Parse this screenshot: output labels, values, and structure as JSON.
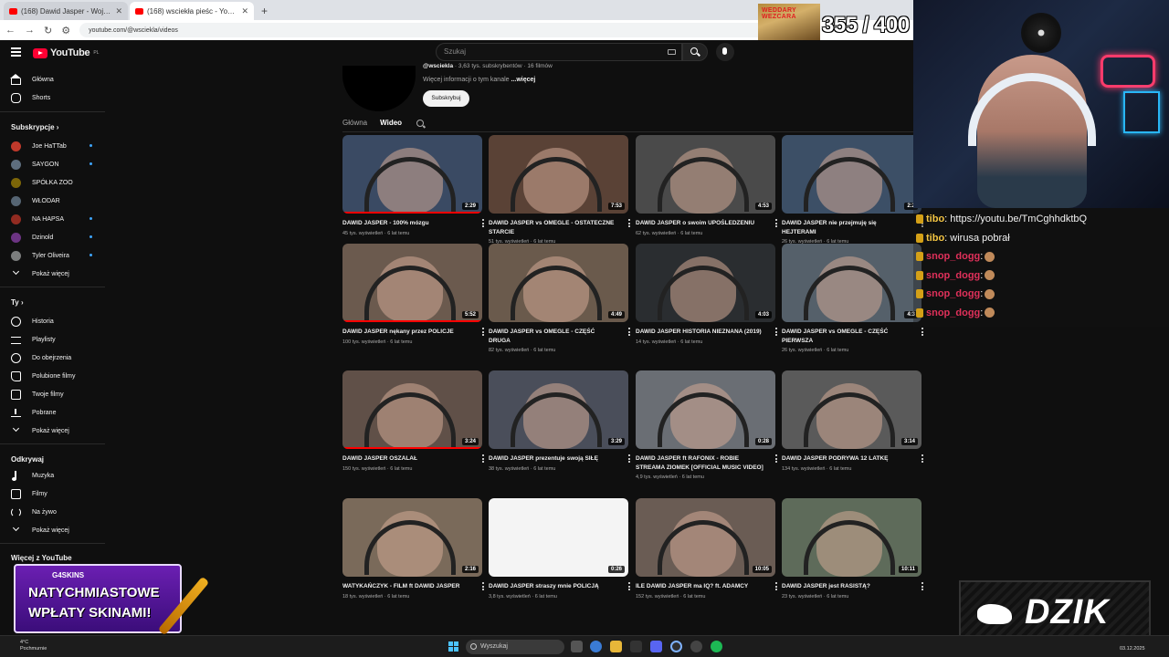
{
  "browser": {
    "tabs": [
      {
        "title": "(168) Dawid Jasper - Wojna z Di..."
      },
      {
        "title": "(168) wsciekła pieśc - YouTube"
      }
    ],
    "url": "youtube.com/@wsciekla/videos"
  },
  "youtube": {
    "logo": "YouTube",
    "logo_region": "PL",
    "search_placeholder": "Szukaj"
  },
  "sidebar": {
    "main": [
      {
        "label": "Główna",
        "icon": "home-icon"
      },
      {
        "label": "Shorts",
        "icon": "shorts-icon"
      }
    ],
    "subs_heading": "Subskrypcje",
    "subscriptions": [
      {
        "label": "Joe HaTTab",
        "color": "#c0392b"
      },
      {
        "label": "SAYGON",
        "color": "#5d6d7e"
      },
      {
        "label": "SPÓŁKA ZOO",
        "color": "#7d6608"
      },
      {
        "label": "WŁODAR",
        "color": "#566573"
      },
      {
        "label": "NA HAPSA",
        "color": "#922b21"
      },
      {
        "label": "Dzinold",
        "color": "#6c3483"
      },
      {
        "label": "Tyler Oliveira",
        "color": "#7b7d7d"
      }
    ],
    "subs_more": "Pokaż więcej",
    "you_heading": "Ty",
    "you": [
      {
        "label": "Historia"
      },
      {
        "label": "Playlisty"
      },
      {
        "label": "Do obejrzenia"
      },
      {
        "label": "Polubione filmy"
      },
      {
        "label": "Twoje filmy"
      },
      {
        "label": "Pobrane"
      },
      {
        "label": "Pokaż więcej"
      }
    ],
    "explore_heading": "Odkrywaj",
    "explore": [
      {
        "label": "Muzyka"
      },
      {
        "label": "Filmy"
      },
      {
        "label": "Na żywo"
      },
      {
        "label": "Pokaż więcej"
      }
    ],
    "more_heading": "Więcej z YouTube"
  },
  "channel": {
    "handle": "@wsciekla",
    "stats": " · 3,63 tys. subskrybentów · 16 filmów",
    "desc": "Więcej informacji o tym kanale ",
    "desc_more": "...więcej",
    "subscribe": "Subskrybuj",
    "tabs": [
      "Główna",
      "Wideo"
    ]
  },
  "videos": [
    {
      "title": "DAWID JASPER - 100% mózgu",
      "meta": "45 tys. wyświetleń · 6 lat temu",
      "duration": "2:29",
      "bg": "#3a4a63"
    },
    {
      "title": "DAWID JASPER vs OMEGLE - OSTATECZNE STARCIE",
      "meta": "51 tys. wyświetleń · 6 lat temu",
      "duration": "7:53",
      "bg": "#5a4236"
    },
    {
      "title": "DAWID JASPER o swoim UPOŚLEDZENIU",
      "meta": "62 tys. wyświetleń · 6 lat temu",
      "duration": "4:53",
      "bg": "#4a4a4a"
    },
    {
      "title": "DAWID JASPER nie przejmuję się HEJTERAMI",
      "meta": "26 tys. wyświetleń · 6 lat temu",
      "duration": "2:2",
      "bg": "#3c4f66"
    },
    {
      "title": "DAWID JASPER nękany przez POLICJE",
      "meta": "100 tys. wyświetleń · 6 lat temu",
      "duration": "5:52",
      "bg": "#6b5a4e"
    },
    {
      "title": "DAWID JASPER vs OMEGLE - CZĘŚĆ DRUGA",
      "meta": "82 tys. wyświetleń · 6 lat temu",
      "duration": "4:49",
      "bg": "#6a5a4c"
    },
    {
      "title": "DAWID JASPER HISTORIA NIEZNANA (2019)",
      "meta": "14 tys. wyświetleń · 6 lat temu",
      "duration": "4:03",
      "bg": "#2a2d30"
    },
    {
      "title": "DAWID JASPER vs OMEGLE - CZĘŚĆ PIERWSZA",
      "meta": "26 tys. wyświetleń · 6 lat temu",
      "duration": "4:3",
      "bg": "#55606a"
    },
    {
      "title": "DAWID JASPER OSZALAŁ",
      "meta": "150 tys. wyświetleń · 6 lat temu",
      "duration": "3:24",
      "bg": "#605048"
    },
    {
      "title": "DAWID JASPER prezentuje swoją SIŁĘ",
      "meta": "38 tys. wyświetleń · 6 lat temu",
      "duration": "3:29",
      "bg": "#4a4e5a"
    },
    {
      "title": "DAWID JASPER ft RAFONIX - ROBIE STREAMA ZIOMEK [OFFICIAL MUSIC VIDEO]",
      "meta": "4,9 tys. wyświetleń · 6 lat temu",
      "duration": "0:28",
      "bg": "#6a6e74"
    },
    {
      "title": "DAWID JASPER PODRYWA 12 LATKĘ",
      "meta": "134 tys. wyświetleń · 6 lat temu",
      "duration": "3:14",
      "bg": "#5a5a5a"
    },
    {
      "title": "WATYKAŃCZYK - FILM ft DAWID JASPER",
      "meta": "18 tys. wyświetleń · 6 lat temu",
      "duration": "2:16",
      "bg": "#7a6a5a"
    },
    {
      "title": "DAWID JASPER straszy mnie POLICJĄ",
      "meta": "3,8 tys. wyświetleń · 6 lat temu",
      "duration": "0:26",
      "bg": "#f4f4f4"
    },
    {
      "title": "ILE DAWID JASPER ma IQ? ft. ADAMCY",
      "meta": "152 tys. wyświetleń · 6 lat temu",
      "duration": "10:05",
      "bg": "#6a5c54"
    },
    {
      "title": "DAWID JASPER jest RASISTĄ?",
      "meta": "23 tys. wyświetleń · 6 lat temu",
      "duration": "10:11",
      "bg": "#5e6b5a"
    }
  ],
  "overlays": {
    "counter": "355 / 400",
    "counter_banner": "WEDDARY WEZCARA",
    "chat": [
      {
        "user": "tibo",
        "color": "#f4c542",
        "text": ": https://youtu.be/TmCghhdktbQ"
      },
      {
        "user": "tibo",
        "color": "#f4c542",
        "text": ": wirusa pobrał"
      },
      {
        "user": "snop_dogg",
        "color": "#e0305a",
        "text": ":"
      },
      {
        "user": "snop_dogg",
        "color": "#e0305a",
        "text": ":"
      },
      {
        "user": "snop_dogg",
        "color": "#e0305a",
        "text": ":"
      },
      {
        "user": "snop_dogg",
        "color": "#e0305a",
        "text": ":"
      }
    ],
    "g4_brand": "G4SKINS",
    "g4_line1": "NATYCHMIASTOWE",
    "g4_line2": "WPŁATY SKINAMI!",
    "dzik": "DZIK"
  },
  "taskbar": {
    "weather_temp": "4°C",
    "weather_desc": "Pochmurnie",
    "search": "Wyszukaj",
    "date": "03.12.2025"
  }
}
